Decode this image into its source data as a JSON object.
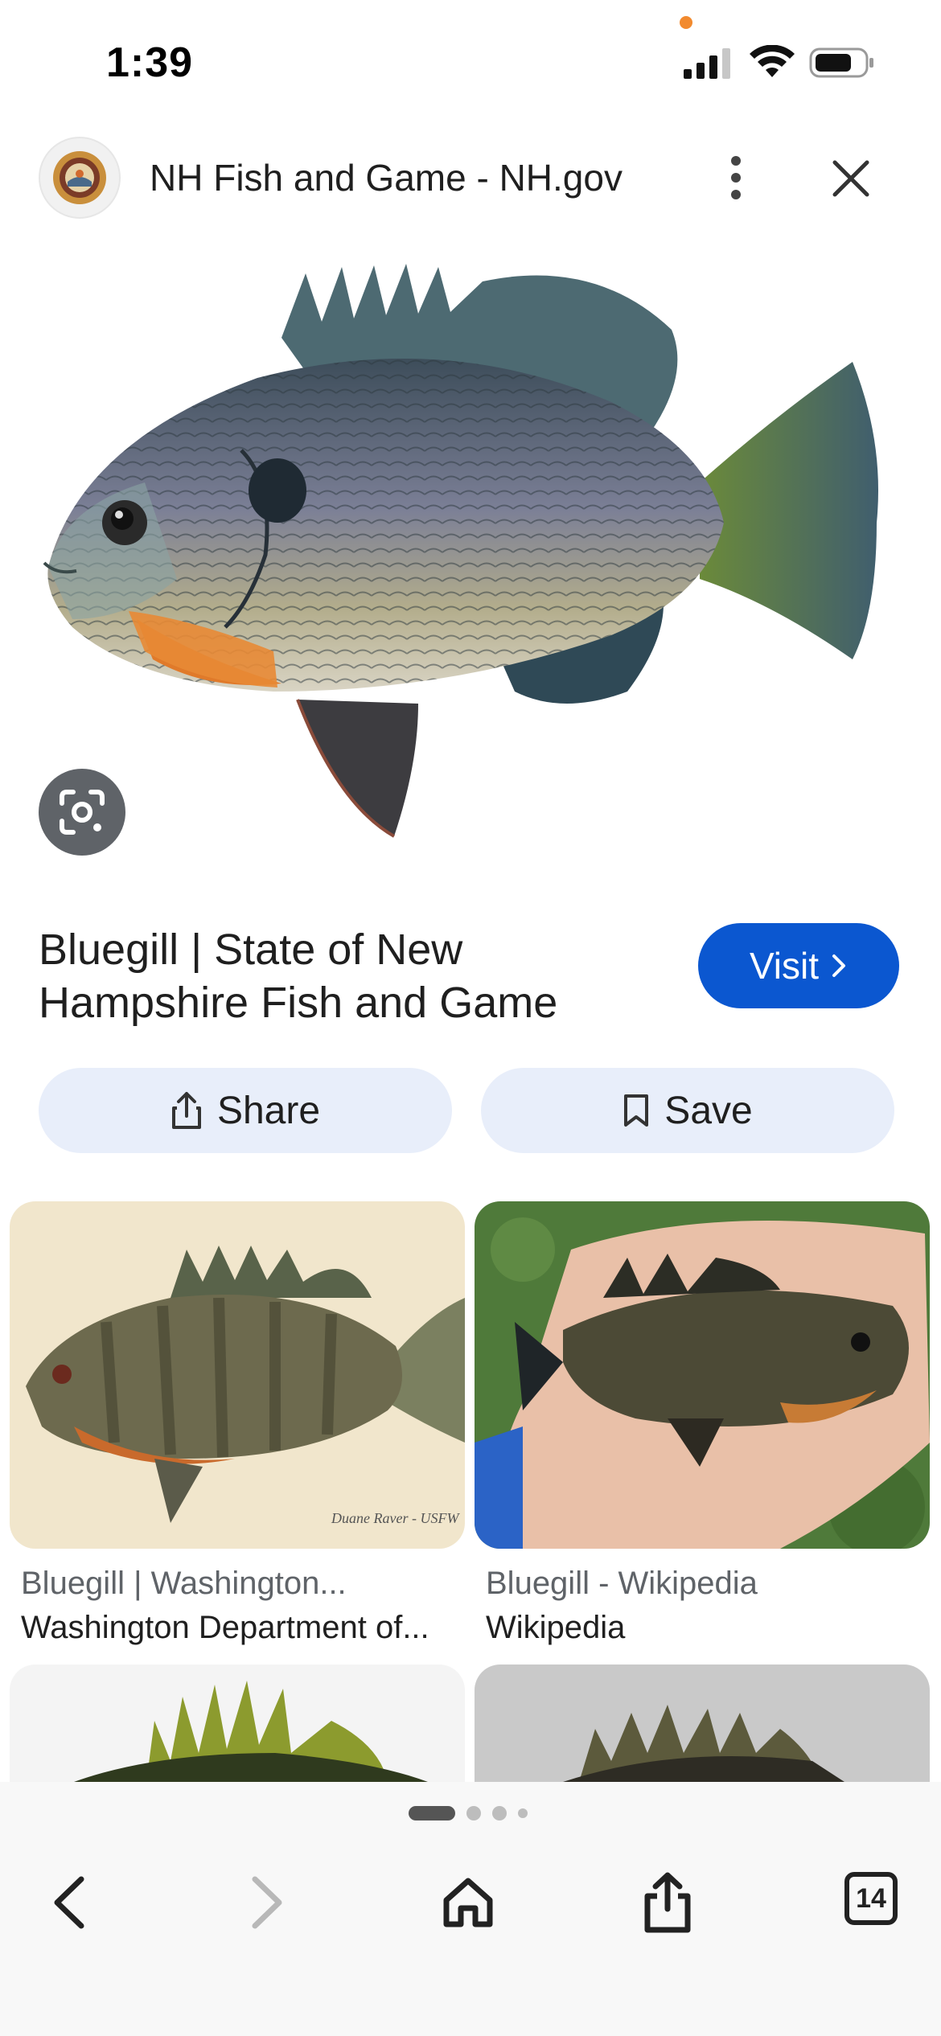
{
  "status_bar": {
    "time": "1:39",
    "privacy_dot_color": "#f28a2e"
  },
  "header": {
    "site_title": "NH Fish and Game - NH.gov",
    "logo_icon": "nh-seal-icon",
    "more_icon": "more-vert-icon",
    "close_icon": "close-icon"
  },
  "hero": {
    "image_subject": "bluegill-fish",
    "lens_icon": "google-lens-icon"
  },
  "result": {
    "title": "Bluegill | State of New Hampshire Fish and Game",
    "visit_label": "Visit",
    "visit_color": "#0b57d0"
  },
  "actions": {
    "share_label": "Share",
    "save_label": "Save"
  },
  "related": [
    {
      "title": "Bluegill | Washington...",
      "site": "Washington Department of..."
    },
    {
      "title": "Bluegill - Wikipedia",
      "site": "Wikipedia"
    }
  ],
  "bottom_nav": {
    "tab_count": "14",
    "page_indicator": {
      "total": 4,
      "active": 1
    }
  }
}
